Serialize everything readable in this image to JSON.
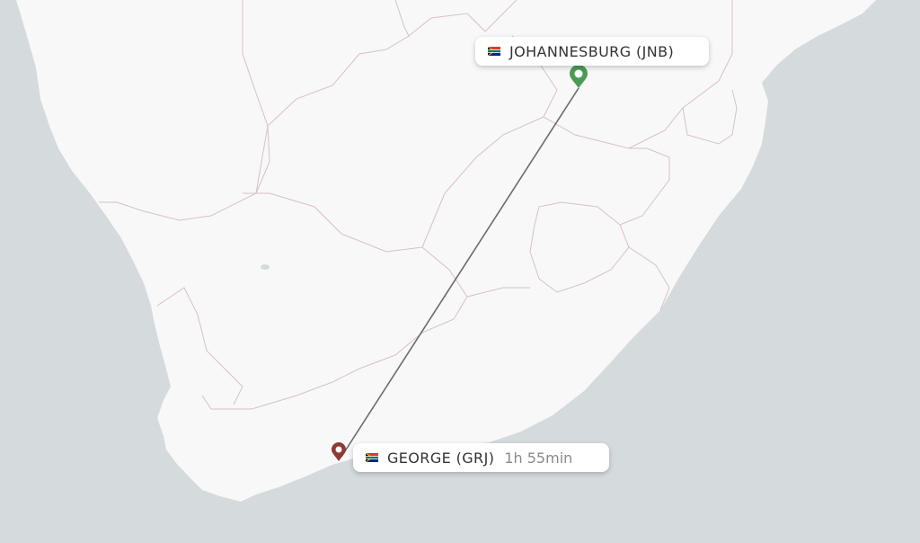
{
  "map": {
    "colors": {
      "sea": "#d5dadd",
      "land": "#f8f8f8",
      "border": "#d8c0c8",
      "route": "#6b6b6b",
      "origin_pin": "#4a9c55",
      "destination_pin": "#8e3a35"
    }
  },
  "origin": {
    "label": "JOHANNESBURG (JNB)",
    "country_flag": "south-africa-flag",
    "pin_icon": "origin-pin-icon"
  },
  "destination": {
    "label": "GEORGE (GRJ)",
    "duration": "1h 55min",
    "country_flag": "south-africa-flag",
    "pin_icon": "destination-pin-icon"
  }
}
